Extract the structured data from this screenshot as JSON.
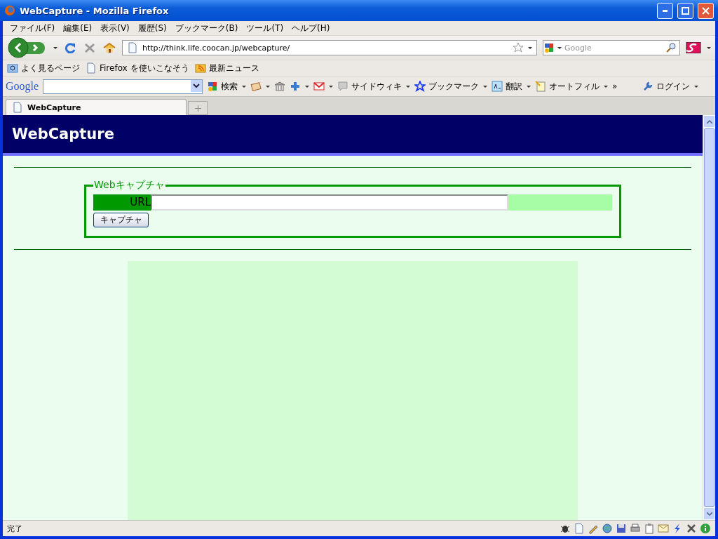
{
  "window": {
    "title": "WebCapture - Mozilla Firefox"
  },
  "menu": [
    "ファイル(F)",
    "編集(E)",
    "表示(V)",
    "履歴(S)",
    "ブックマーク(B)",
    "ツール(T)",
    "ヘルプ(H)"
  ],
  "navigation": {
    "url": "http://think.life.coocan.jp/webcapture/",
    "search_placeholder": "Google"
  },
  "bookmarks": [
    "よく見るページ",
    "Firefox を使いこなそう",
    "最新ニュース"
  ],
  "google_toolbar": {
    "logo": "Google",
    "items": [
      "検索",
      "サイドウィキ",
      "ブックマーク",
      "翻訳",
      "オートフィル",
      "»",
      "ログイン"
    ]
  },
  "tabs": [
    {
      "label": "WebCapture",
      "selected": true
    }
  ],
  "page": {
    "header": "WebCapture",
    "legend": "Webキャプチャ",
    "url_label": "URL",
    "button": "キャプチャ"
  },
  "status_bar": {
    "text": "完了"
  }
}
